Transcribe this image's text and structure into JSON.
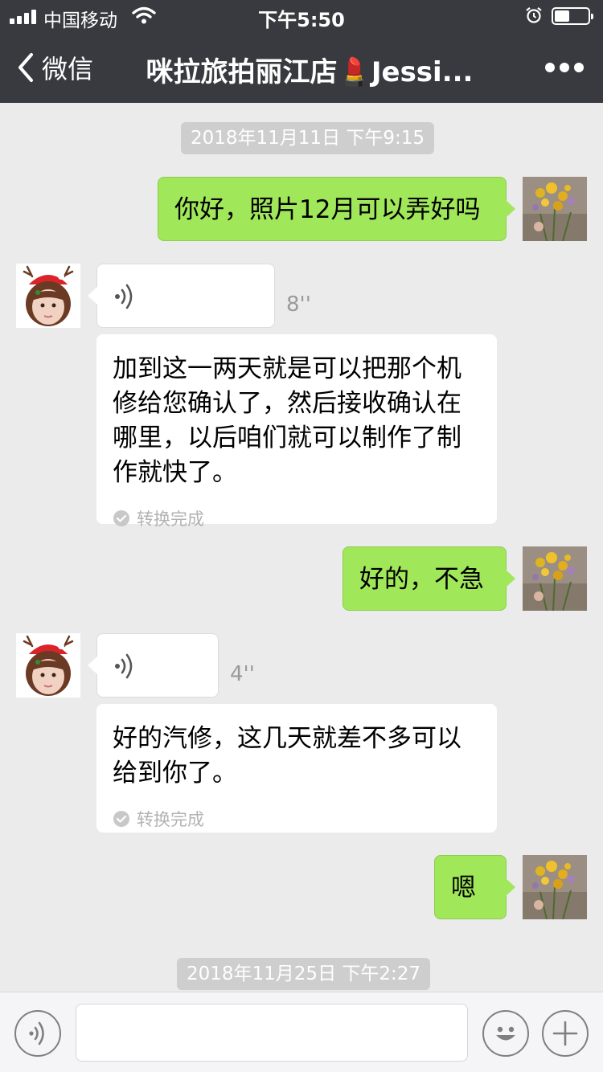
{
  "status_bar": {
    "carrier": "中国移动",
    "time": "下午5:50",
    "battery_level": 0.45
  },
  "nav": {
    "back_label": "微信",
    "title": "咪拉旅拍丽江店💄Jessi...",
    "more_icon": "more-dots-icon"
  },
  "chat": {
    "timestamps": [
      "2018年11月11日 下午9:15",
      "2018年11月25日 下午2:27"
    ],
    "messages": [
      {
        "sender": "me",
        "type": "text",
        "text": "你好，照片12月可以弄好吗"
      },
      {
        "sender": "contact",
        "type": "voice",
        "duration": "8''",
        "transcript": "加到这一两天就是可以把那个机修给您确认了，然后接收确认在哪里，以后咱们就可以制作了制作就快了。",
        "transcript_lines": [
          "加到这一两天就是可以把那个机",
          "修给您确认了，然后接收确认在",
          "哪里，以后咱们就可以制作了制",
          "作就快了。"
        ],
        "status": "转换完成"
      },
      {
        "sender": "me",
        "type": "text",
        "text": "好的，不急"
      },
      {
        "sender": "contact",
        "type": "voice",
        "duration": "4''",
        "transcript": "好的汽修，这几天就差不多可以给到你了。",
        "transcript_lines": [
          "好的汽修，这几天就差不多可以",
          "给到你了。"
        ],
        "status": "转换完成"
      },
      {
        "sender": "me",
        "type": "text",
        "text": "嗯"
      }
    ]
  },
  "input_bar": {
    "voice_icon": "voice-mode-icon",
    "emoji_icon": "emoji-icon",
    "plus_icon": "plus-icon",
    "text_value": ""
  },
  "colors": {
    "nav_bg": "#393a3f",
    "chat_bg": "#ebebeb",
    "my_bubble": "#a0e75a",
    "their_bubble": "#ffffff"
  }
}
